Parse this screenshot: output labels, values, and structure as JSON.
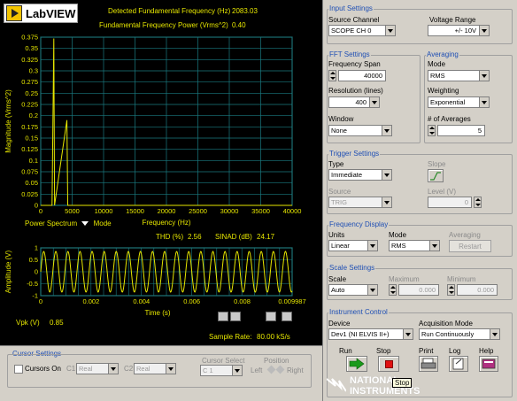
{
  "logo": {
    "text": "LabVIEW"
  },
  "readouts": {
    "fund_freq_label": "Detected Fundamental Frequency (Hz)",
    "fund_freq_value": "2083.03",
    "fund_power_label": "Fundamental Frequency Power (Vrms^2)",
    "fund_power_value": "0.40",
    "thd_label": "THD (%)",
    "thd_value": "2.56",
    "sinad_label": "SINAD (dB)",
    "sinad_value": "24.17",
    "vpk_label": "Vpk (V)",
    "vpk_value": "0.85",
    "sample_rate_label": "Sample Rate:",
    "sample_rate_value": "80.00 kS/s"
  },
  "spectrum_controls": {
    "power_spectrum": "Power Spectrum",
    "mode": "Mode"
  },
  "chart_data": [
    {
      "type": "line",
      "ylabel": "Magnitude (Vrms^2)",
      "xlabel": "Frequency (Hz)",
      "xlim": [
        0,
        40000
      ],
      "ylim": [
        0,
        0.375
      ],
      "x_ticks": [
        "0",
        "5000",
        "10000",
        "15000",
        "20000",
        "25000",
        "30000",
        "35000",
        "40000"
      ],
      "y_ticks": [
        "0",
        "0.025",
        "0.05",
        "0.075",
        "0.1",
        "0.125",
        "0.15",
        "0.175",
        "0.2",
        "0.225",
        "0.25",
        "0.275",
        "0.3",
        "0.325",
        "0.35",
        "0.375"
      ],
      "grid": true,
      "series": [
        {
          "x": [
            0,
            1800,
            2083,
            2200,
            4166,
            4300,
            6249,
            6400,
            40000
          ],
          "y": [
            0,
            0,
            0.372,
            0,
            0.19,
            0,
            0,
            0,
            0
          ],
          "color": "#e6e600"
        }
      ]
    },
    {
      "type": "line",
      "ylabel": "Amplitude (V)",
      "xlabel": "Time (s)",
      "xlim": [
        0,
        0.009987
      ],
      "ylim": [
        -1,
        1
      ],
      "x_ticks": [
        "0",
        "0.002",
        "0.004",
        "0.006",
        "0.008",
        "0.009987"
      ],
      "y_ticks": [
        "-1",
        "-0.5",
        "0",
        "0.5",
        "1"
      ],
      "grid": true,
      "series": [
        {
          "frequency_hz": 2083.03,
          "amplitude": 0.85,
          "color": "#e6e600"
        }
      ]
    }
  ],
  "cursor_settings": {
    "title": "Cursor Settings",
    "cursors_on": "Cursors On",
    "c1": "C1",
    "c1_value": "Real",
    "c2": "C2",
    "c2_value": "Real",
    "cursor_select_label": "Cursor Select",
    "cursor_select_value": "C 1",
    "position_label": "Position",
    "left": "Left",
    "right": "Right"
  },
  "input_settings": {
    "title": "Input Settings",
    "source_channel_label": "Source Channel",
    "source_channel_value": "SCOPE CH 0",
    "voltage_range_label": "Voltage Range",
    "voltage_range_value": "+/- 10V"
  },
  "fft_settings": {
    "title": "FFT Settings",
    "freq_span_label": "Frequency Span",
    "freq_span_value": "40000",
    "resolution_label": "Resolution (lines)",
    "resolution_value": "400",
    "window_label": "Window",
    "window_value": "None"
  },
  "averaging": {
    "title": "Averaging",
    "mode_label": "Mode",
    "mode_value": "RMS",
    "weighting_label": "Weighting",
    "weighting_value": "Exponential",
    "num_avg_label": "# of Averages",
    "num_avg_value": "5"
  },
  "trigger_settings": {
    "title": "Trigger Settings",
    "type_label": "Type",
    "type_value": "Immediate",
    "slope_label": "Slope",
    "source_label": "Source",
    "source_value": "TRIG",
    "level_label": "Level (V)",
    "level_value": "0"
  },
  "frequency_display": {
    "title": "Frequency Display",
    "units_label": "Units",
    "units_value": "Linear",
    "mode_label": "Mode",
    "mode_value": "RMS",
    "averaging_label": "Averaging",
    "restart_label": "Restart"
  },
  "scale_settings": {
    "title": "Scale Settings",
    "scale_label": "Scale",
    "scale_value": "Auto",
    "max_label": "Maximum",
    "max_value": "0.000",
    "min_label": "Minimum",
    "min_value": "0.000"
  },
  "instrument_control": {
    "title": "Instrument Control",
    "device_label": "Device",
    "device_value": "Dev1 (NI ELVIS II+)",
    "acq_mode_label": "Acquisition Mode",
    "acq_mode_value": "Run Continuously",
    "run_label": "Run",
    "stop_label": "Stop",
    "print_label": "Print",
    "log_label": "Log",
    "help_label": "Help",
    "tooltip": "Stop"
  },
  "brand": {
    "line1": "NATIONAL",
    "line2": "INSTRUMENTS"
  }
}
